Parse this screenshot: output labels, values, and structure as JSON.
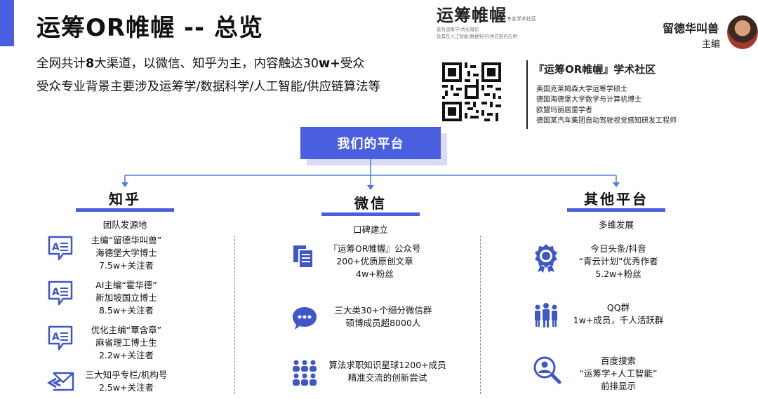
{
  "header": {
    "title": "运筹OR帷幄 -- 总览",
    "intro_line1_pre": "全网共计",
    "intro_line1_num": "8",
    "intro_line1_post": "大渠道，以微信、知乎为主，内容触达30",
    "intro_line1_w": "w+",
    "intro_line1_end": "受众",
    "intro_line2": "受众专业背景主要涉及运筹学/数据科学/人工智能/供应链算法等"
  },
  "logo": {
    "main": "运筹帷幄",
    "tag": "专业学术社区",
    "sub1": "普及运筹学|优化理论",
    "sub2": "及其在人工智能|数据科学|供应链的应用"
  },
  "editor": {
    "name": "留德华叫兽",
    "role": "主编"
  },
  "community": {
    "title": "『运筹OR帷幄』学术社区",
    "items": [
      "美国克莱姆森大学运筹学硕士",
      "德国海德堡大学数学与计算机博士",
      "欧盟玛丽居里学者",
      "德国某汽车集团自动驾驶视觉感知研发工程师"
    ]
  },
  "platform": {
    "label": "我们的平台"
  },
  "columns": {
    "zhihu": {
      "head": "知乎",
      "sub": "团队发源地",
      "items": [
        {
          "l1": "主编“留德华叫兽”",
          "l2": "海德堡大学博士",
          "l3": "7.5w+关注者"
        },
        {
          "l1": "AI主编“霍华德”",
          "l2": "新加坡国立博士",
          "l3": "8.5w+关注者"
        },
        {
          "l1": "优化主编“覃含章”",
          "l2": "麻省理工博士生",
          "l3": "2.2w+关注者"
        },
        {
          "l1": "三大知乎专栏/机构号",
          "l2": "2.5w+关注者"
        }
      ]
    },
    "wechat": {
      "head": "微信",
      "sub": "口碑建立",
      "items": [
        {
          "l1": "『运筹OR帷幄』公众号",
          "l2": "200+优质原创文章",
          "l3": "4w+粉丝"
        },
        {
          "l1": "三大类30+个细分微信群",
          "l2": "硕博成员超8000人"
        },
        {
          "l1": "算法求职知识星球1200+成员",
          "l2": "精准交流的创新尝试"
        }
      ]
    },
    "other": {
      "head": "其他平台",
      "sub": "多维发展",
      "items": [
        {
          "l1": "今日头条/抖音",
          "l2": "“青云计划”优秀作者",
          "l3": "5.2w+粉丝"
        },
        {
          "l1": "QQ群",
          "l2": "1w+成员，千人活跃群"
        },
        {
          "l1": "百度搜索",
          "l2": "“运筹学+人工智能”",
          "l3": "前排显示"
        }
      ]
    }
  },
  "colors": {
    "accent": "#4a5fe0",
    "icon": "#3f57c9"
  }
}
